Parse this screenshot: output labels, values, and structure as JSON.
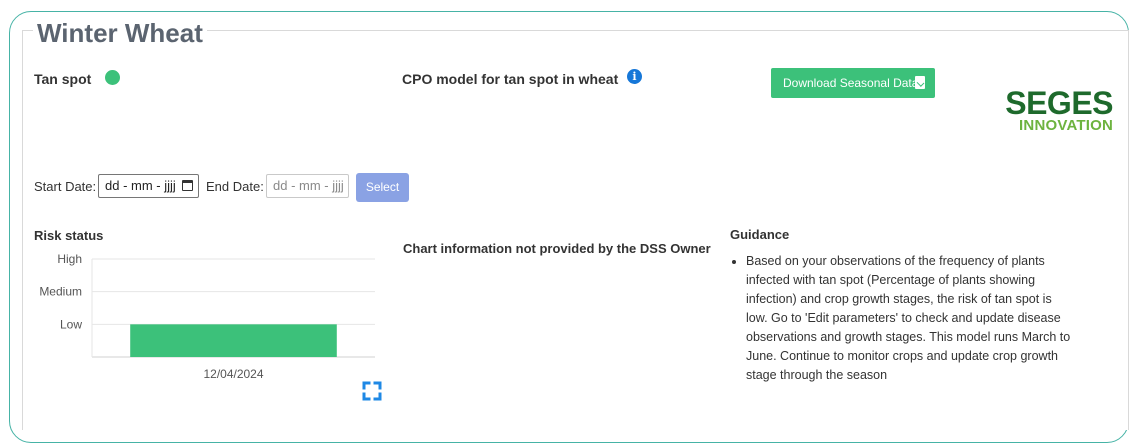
{
  "header": {
    "title": "Winter Wheat"
  },
  "disease": {
    "name": "Tan spot",
    "status_color": "#3cc17a"
  },
  "model": {
    "title": "CPO model for tan spot in wheat",
    "info_icon": "info-icon"
  },
  "download": {
    "label": "Download Seasonal Data",
    "icon": "file-download-icon"
  },
  "logo": {
    "line1": "SEGES",
    "line2": "INNOVATION"
  },
  "dates": {
    "start_label": "Start Date:",
    "start_value": "dd - mm - jjjj",
    "end_label": "End Date:",
    "end_value": "dd - mm - jjjj",
    "select_label": "Select"
  },
  "risk": {
    "heading": "Risk status"
  },
  "chart_info": {
    "message": "Chart information not provided by the DSS Owner"
  },
  "guidance": {
    "heading": "Guidance",
    "items": [
      "Based on your observations of the frequency of plants infected with tan spot (Percentage of plants showing infection) and crop growth stages, the risk of tan spot is low. Go to 'Edit parameters' to check and update disease observations and growth stages. This model runs March to June. Continue to monitor crops and update crop growth stage through the season"
    ]
  },
  "chart_data": {
    "type": "bar",
    "categories": [
      "12/04/2024"
    ],
    "levels": [
      "Low",
      "Medium",
      "High"
    ],
    "values": [
      "Low"
    ],
    "value_index": [
      1
    ],
    "color": "#3cc17a",
    "grid": true
  },
  "colors": {
    "accent": "#3cc17a",
    "frame": "#46b3a6",
    "select_button": "#8aa2e4",
    "info": "#1677d8"
  }
}
